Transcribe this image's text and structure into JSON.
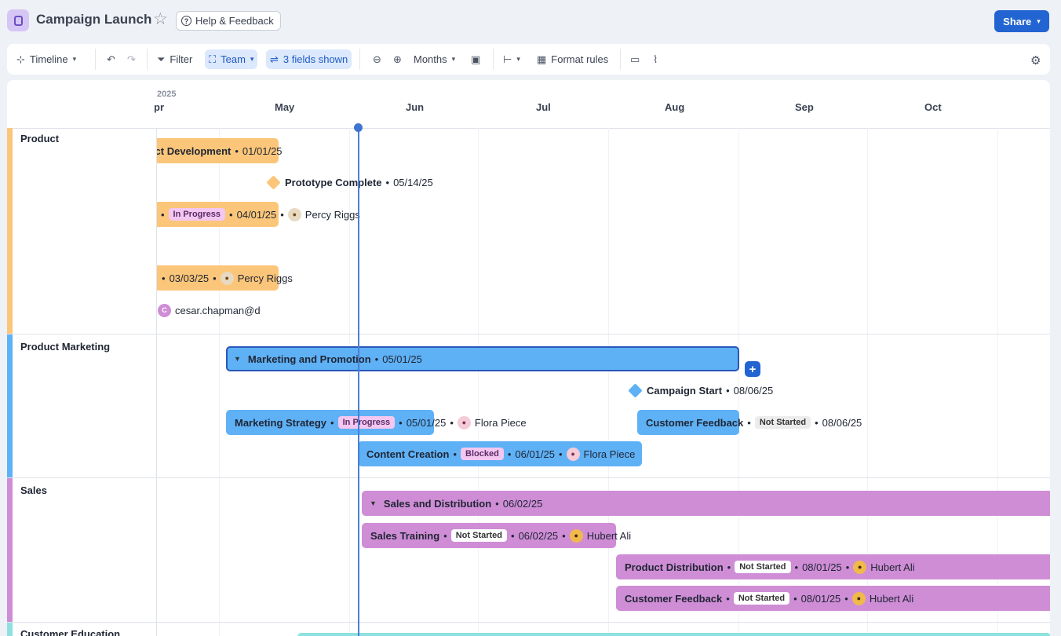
{
  "header": {
    "title": "Campaign Launch",
    "help_label": "Help & Feedback",
    "share_label": "Share"
  },
  "toolbar": {
    "view_label": "Timeline",
    "filter_label": "Filter",
    "group_label": "Team",
    "fields_label": "3 fields shown",
    "scale_label": "Months",
    "format_label": "Format rules"
  },
  "timeline": {
    "year": "2025",
    "months": [
      "Apr",
      "May",
      "Jun",
      "Jul",
      "Aug",
      "Sep",
      "Oct"
    ],
    "groups": [
      {
        "label": "Product",
        "color": "#fbc679"
      },
      {
        "label": "Product Marketing",
        "color": "#5fb1f6"
      },
      {
        "label": "Sales",
        "color": "#cf8dd6"
      },
      {
        "label": "Customer Education",
        "color": "#8ee1df"
      }
    ]
  },
  "items": {
    "product_dev": {
      "name": "Product Development",
      "date": "01/01/25"
    },
    "prototype": {
      "name": "Prototype Complete",
      "date": "05/14/25"
    },
    "product_testing": {
      "status": "In Progress",
      "date": "04/01/25",
      "owner": "Percy Riggs"
    },
    "product_row4": {
      "date": "03/03/25",
      "owner": "Percy Riggs"
    },
    "product_row5": {
      "owner_initial": "C",
      "owner": "cesar.chapman@d"
    },
    "mkt_promo": {
      "name": "Marketing and Promotion",
      "date": "05/01/25"
    },
    "campaign_start": {
      "name": "Campaign Start",
      "date": "08/06/25"
    },
    "mkt_strategy": {
      "name": "Marketing Strategy",
      "status": "In Progress",
      "date": "05/01/25",
      "owner": "Flora Piece"
    },
    "cust_feedback_mkt": {
      "name": "Customer Feedback",
      "status": "Not Started",
      "date": "08/06/25"
    },
    "content_creation": {
      "name": "Content Creation",
      "status": "Blocked",
      "date": "06/01/25",
      "owner": "Flora Piece"
    },
    "sales_dist": {
      "name": "Sales and Distribution",
      "date": "06/02/25"
    },
    "sales_training": {
      "name": "Sales Training",
      "status": "Not Started",
      "date": "06/02/25",
      "owner": "Hubert Ali"
    },
    "product_distribution": {
      "name": "Product Distribution",
      "status": "Not Started",
      "date": "08/01/25",
      "owner": "Hubert Ali"
    },
    "cust_feedback_sales": {
      "name": "Customer Feedback",
      "status": "Not Started",
      "date": "08/01/25",
      "owner": "Hubert Ali"
    }
  }
}
